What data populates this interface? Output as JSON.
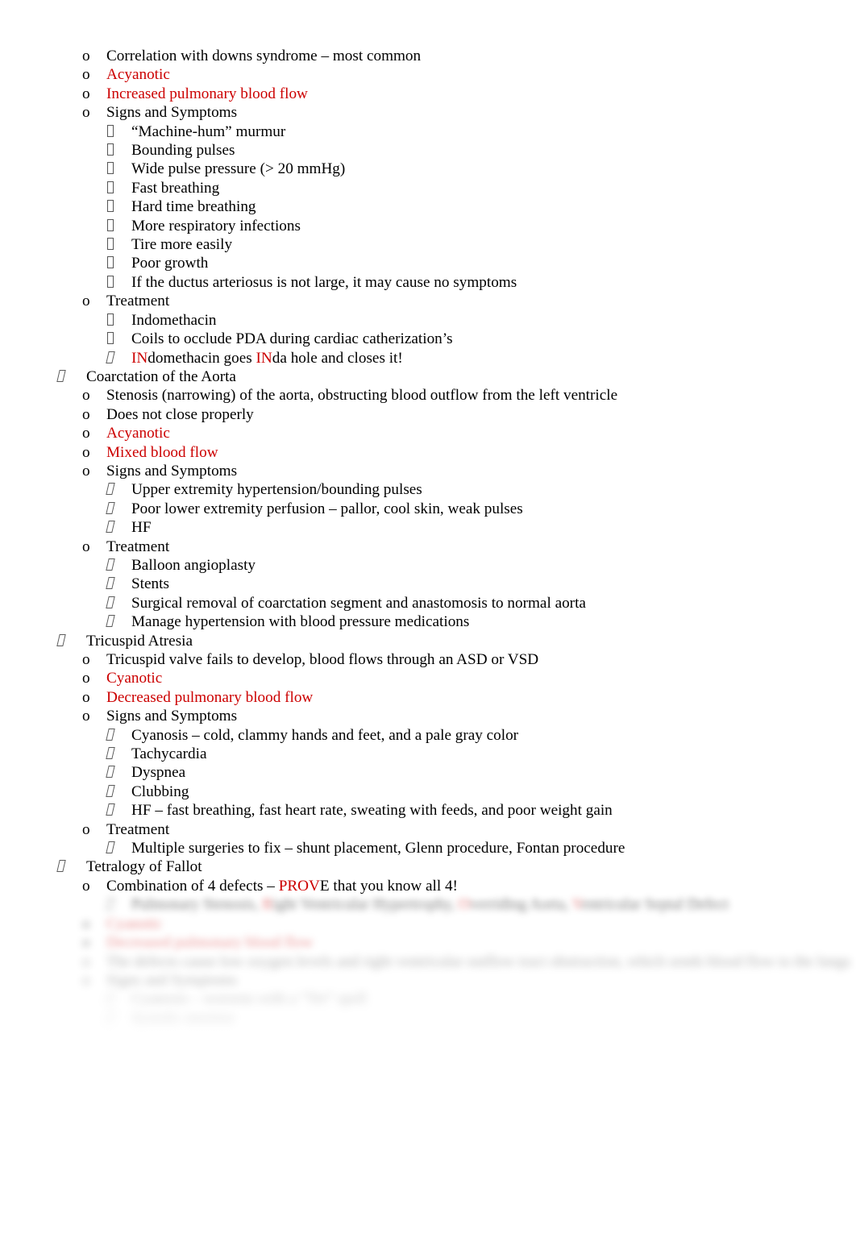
{
  "document": {
    "page_background": "#ffffff",
    "text_color": "#000000",
    "accent_color": "#CC0000",
    "bullet_level1_glyph": "tofu-slanted-box",
    "bullet_level2_glyph": "letter-o",
    "bullet_level3_glyph": "tofu-box"
  },
  "lines": [
    {
      "id": "l01",
      "marker": "o",
      "text": "Correlation with downs syndrome – most common"
    },
    {
      "id": "l02",
      "marker": "o",
      "text": "Acyanotic"
    },
    {
      "id": "l03",
      "marker": "o",
      "text": "Increased pulmonary blood flow"
    },
    {
      "id": "l04",
      "marker": "o",
      "text": "Signs and Symptoms"
    },
    {
      "id": "l05",
      "marker": "box",
      "text": "“Machine-hum” murmur"
    },
    {
      "id": "l06",
      "marker": "box",
      "text": "Bounding pulses"
    },
    {
      "id": "l07",
      "marker": "box",
      "text": "Wide pulse pressure (> 20 mmHg)"
    },
    {
      "id": "l08",
      "marker": "box",
      "text": "Fast breathing"
    },
    {
      "id": "l09",
      "marker": "box",
      "text": "Hard time breathing"
    },
    {
      "id": "l10",
      "marker": "box",
      "text": "More respiratory infections"
    },
    {
      "id": "l11",
      "marker": "box",
      "text": "Tire more easily"
    },
    {
      "id": "l12",
      "marker": "box",
      "text": "Poor growth"
    },
    {
      "id": "l13",
      "marker": "box",
      "text": "If the ductus arteriosus is not large, it may cause no symptoms"
    },
    {
      "id": "l14",
      "marker": "o",
      "text": "Treatment"
    },
    {
      "id": "l15",
      "marker": "box",
      "text": "Indomethacin"
    },
    {
      "id": "l16",
      "marker": "box",
      "text": "Coils to occlude PDA during cardiac catherization’s"
    },
    {
      "id": "l17",
      "marker": "slant",
      "segments": [
        {
          "t": "IN",
          "c": "red"
        },
        {
          "t": "domethacin goes  ",
          "c": "black"
        },
        {
          "t": "IN",
          "c": "red"
        },
        {
          "t": "da hole and closes it!",
          "c": "black"
        }
      ]
    },
    {
      "id": "l18",
      "marker": "slant",
      "text": "Coarctation of the Aorta"
    },
    {
      "id": "l19",
      "marker": "o",
      "text": "Stenosis (narrowing) of the aorta, obstructing blood outflow from the left ventricle"
    },
    {
      "id": "l20",
      "marker": "o",
      "text": "Does not close properly"
    },
    {
      "id": "l21",
      "marker": "o",
      "text": "Acyanotic"
    },
    {
      "id": "l22",
      "marker": "o",
      "text": "Mixed blood flow"
    },
    {
      "id": "l23",
      "marker": "o",
      "text": "Signs and Symptoms"
    },
    {
      "id": "l24",
      "marker": "slant",
      "text": "Upper extremity hypertension/bounding pulses"
    },
    {
      "id": "l25",
      "marker": "slant",
      "text": "Poor lower extremity perfusion – pallor, cool skin, weak pulses"
    },
    {
      "id": "l26",
      "marker": "slant",
      "text": "HF"
    },
    {
      "id": "l27",
      "marker": "o",
      "text": "Treatment"
    },
    {
      "id": "l28",
      "marker": "slant",
      "text": "Balloon angioplasty"
    },
    {
      "id": "l29",
      "marker": "slant",
      "text": "Stents"
    },
    {
      "id": "l30",
      "marker": "slant",
      "text": "Surgical removal of coarctation segment and anastomosis to normal aorta"
    },
    {
      "id": "l31",
      "marker": "slant",
      "text": "Manage hypertension with blood pressure medications"
    },
    {
      "id": "l32",
      "marker": "slant",
      "text": "Tricuspid Atresia"
    },
    {
      "id": "l33",
      "marker": "o",
      "text": "Tricuspid valve fails to develop, blood flows through an ASD or VSD"
    },
    {
      "id": "l34",
      "marker": "o",
      "text": "Cyanotic"
    },
    {
      "id": "l35",
      "marker": "o",
      "text": "Decreased pulmonary blood flow"
    },
    {
      "id": "l36",
      "marker": "o",
      "text": "Signs and Symptoms"
    },
    {
      "id": "l37",
      "marker": "slant",
      "text": "Cyanosis – cold, clammy hands and feet, and a pale gray color"
    },
    {
      "id": "l38",
      "marker": "slant",
      "text": "Tachycardia"
    },
    {
      "id": "l39",
      "marker": "slant",
      "text": "Dyspnea"
    },
    {
      "id": "l40",
      "marker": "slant",
      "text": "Clubbing"
    },
    {
      "id": "l41",
      "marker": "slant",
      "text": "HF – fast breathing, fast heart rate, sweating with feeds, and poor weight gain"
    },
    {
      "id": "l42",
      "marker": "o",
      "text": "Treatment"
    },
    {
      "id": "l43",
      "marker": "slant",
      "text": "Multiple surgeries to fix – shunt placement, Glenn procedure, Fontan procedure"
    },
    {
      "id": "l44",
      "marker": "slant",
      "text": "Tetralogy of Fallot"
    },
    {
      "id": "l45",
      "marker": "o",
      "segments": [
        {
          "t": "Combination of 4 defects – ",
          "c": "black"
        },
        {
          "t": "PROV",
          "c": "red"
        },
        {
          "t": "E that you know all 4!",
          "c": "black"
        }
      ]
    }
  ],
  "obscured": {
    "note": "lower portion of page is blurred and not legible",
    "lines": [
      {
        "id": "b01",
        "marker": "slant",
        "segments": [
          {
            "t": "Pulmonary Stenosis, ",
            "c": "black"
          },
          {
            "t": "R",
            "c": "red"
          },
          {
            "t": "ight Ventricular Hypertrophy, ",
            "c": "black"
          },
          {
            "t": "O",
            "c": "red"
          },
          {
            "t": "verriding Aorta, ",
            "c": "black"
          },
          {
            "t": "V",
            "c": "red"
          },
          {
            "t": "entricular Septal Defect",
            "c": "black"
          }
        ]
      },
      {
        "id": "b02",
        "marker": "o",
        "segments": [
          {
            "t": "Cyanotic",
            "c": "red"
          }
        ]
      },
      {
        "id": "b03",
        "marker": "o",
        "segments": [
          {
            "t": "Decreased pulmonary blood flow",
            "c": "red"
          }
        ]
      },
      {
        "id": "b04",
        "marker": "o",
        "segments": [
          {
            "t": "The defects cause low oxygen levels and right ventricular outflow tract obstruction, which sends blood flow to the lungs",
            "c": "black"
          }
        ]
      },
      {
        "id": "b05",
        "marker": "o",
        "segments": [
          {
            "t": "Signs and Symptoms",
            "c": "black"
          }
        ]
      },
      {
        "id": "b06",
        "marker": "slant",
        "segments": [
          {
            "t": "Cyanosis – worsens with a “Tet” spell",
            "c": "black"
          }
        ]
      },
      {
        "id": "b07",
        "marker": "slant",
        "segments": [
          {
            "t": "Systolic murmur",
            "c": "black"
          }
        ]
      }
    ]
  }
}
